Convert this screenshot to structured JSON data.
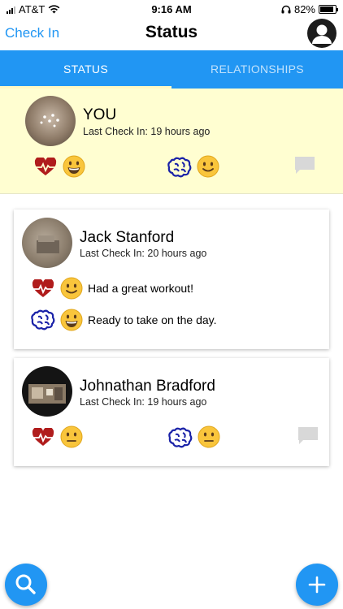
{
  "status_bar": {
    "carrier": "AT&T",
    "time": "9:16 AM",
    "battery": "82%",
    "battery_level": 0.82
  },
  "nav": {
    "left_action": "Check In",
    "title": "Status",
    "profile_icon": "person-circle-icon"
  },
  "tabs": [
    {
      "label": "STATUS",
      "active": true
    },
    {
      "label": "RELATIONSHIPS",
      "active": false
    }
  ],
  "self": {
    "name": "YOU",
    "last_check_in": "Last Check In: 19 hours ago",
    "physical": {
      "icon": "heart-pulse-icon",
      "mood": "grinning-emoji"
    },
    "mental": {
      "icon": "brain-icon",
      "mood": "smiling-emoji"
    }
  },
  "contacts": [
    {
      "name": "Jack Stanford",
      "last_check_in": "Last Check In: 20 hours ago",
      "physical": {
        "icon": "heart-pulse-icon",
        "mood": "smiling-emoji",
        "note": "Had a great workout!"
      },
      "mental": {
        "icon": "brain-icon",
        "mood": "grinning-emoji",
        "note": "Ready to take on the day."
      }
    },
    {
      "name": "Johnathan Bradford",
      "last_check_in": "Last Check In: 19 hours ago",
      "physical": {
        "icon": "heart-pulse-icon",
        "mood": "neutral-emoji"
      },
      "mental": {
        "icon": "brain-icon",
        "mood": "neutral-emoji"
      }
    }
  ],
  "fabs": {
    "left": "search-icon",
    "right": "plus-icon"
  },
  "colors": {
    "accent": "#2196f3",
    "self_bg": "#fffed1",
    "heart": "#b01c1c",
    "brain": "#1a22a8"
  }
}
